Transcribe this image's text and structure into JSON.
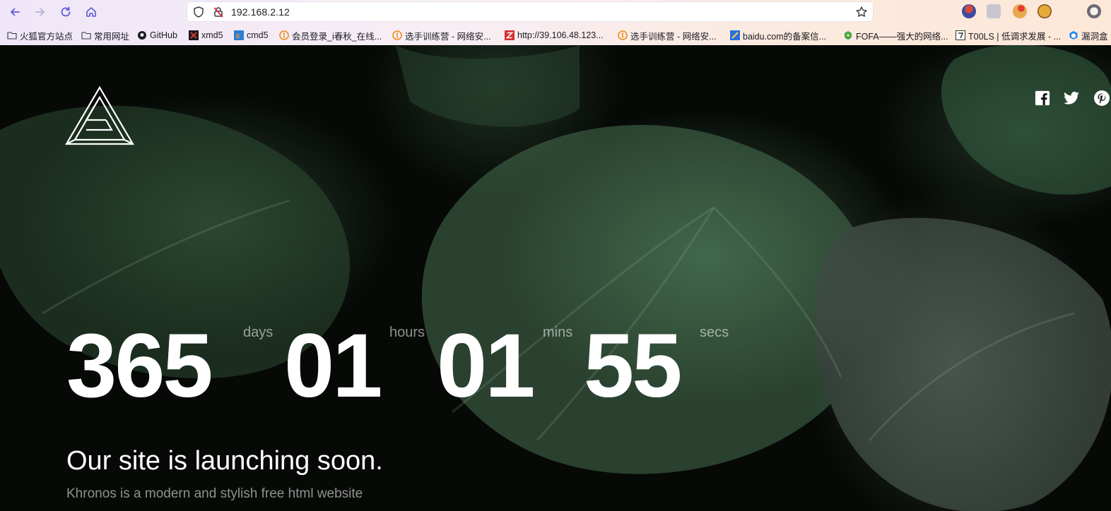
{
  "browser": {
    "url": "192.168.2.12",
    "bookmarks": [
      {
        "label": "火狐官方站点",
        "icon": "folder-icon"
      },
      {
        "label": "常用网址",
        "icon": "folder-icon"
      },
      {
        "label": "GitHub",
        "icon": "github-icon"
      },
      {
        "label": "xmd5",
        "icon": "xmd5-icon"
      },
      {
        "label": "cmd5",
        "icon": "cmd5-icon"
      },
      {
        "label": "会员登录_i春秋_在线...",
        "icon": "ichunqiu-icon"
      },
      {
        "label": "选手训练营 - 网络安...",
        "icon": "ichunqiu-icon"
      },
      {
        "label": "http://39.106.48.123...",
        "icon": "z-icon"
      },
      {
        "label": "选手训练营 - 网络安...",
        "icon": "ichunqiu-icon"
      },
      {
        "label": "baidu.com的备案信...",
        "icon": "baidu-icon"
      },
      {
        "label": "FOFA——强大的网络...",
        "icon": "fofa-icon"
      },
      {
        "label": "T00LS | 低调求发展 - ...",
        "icon": "t00ls-icon"
      },
      {
        "label": "漏洞盒",
        "icon": "vulbox-icon"
      }
    ]
  },
  "page": {
    "countdown": {
      "days": "365",
      "days_label": "days",
      "hours": "01",
      "hours_label": "hours",
      "mins": "01",
      "mins_label": "mins",
      "secs": "55",
      "secs_label": "secs"
    },
    "headline": "Our site is launching soon.",
    "subtext": "Khronos is a modern and stylish free html website"
  },
  "colors": {
    "text_primary": "#ffffff",
    "text_muted": "#9aa39c",
    "background": "#060906"
  }
}
